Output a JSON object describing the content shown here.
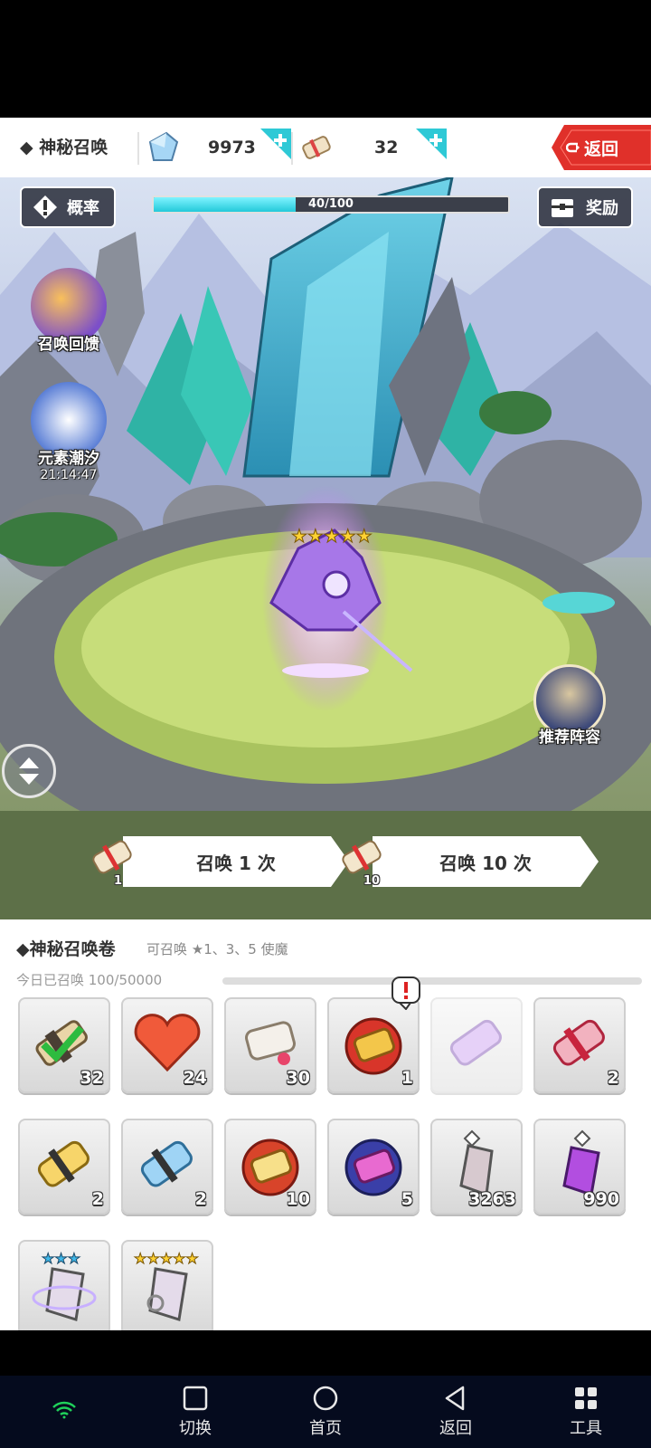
{
  "header": {
    "title": "◆ 神秘召唤",
    "gems": "9973",
    "scrolls": "32",
    "back_label": "返回"
  },
  "scene": {
    "rate_label": "概率",
    "reward_label": "奖励",
    "progress_text": "40/100",
    "progress_value": 0.4,
    "side_feedback_label": "召唤回馈",
    "side_element_label": "元素潮汐",
    "side_element_timer": "21:14:47",
    "recommend_label": "推荐阵容",
    "summon_one_label": "召唤 1 次",
    "summon_one_cost": "1",
    "summon_ten_label": "召唤 10 次",
    "summon_ten_cost": "10"
  },
  "panel": {
    "title": "◆神秘召唤卷",
    "subtitle": "可召唤 ★1、3、5 使魔",
    "today": "今日已召唤 100/50000",
    "items": [
      {
        "icon": "scroll-check-icon",
        "count": "32"
      },
      {
        "icon": "heart-icon",
        "count": "24"
      },
      {
        "icon": "white-scroll-icon",
        "count": "30"
      },
      {
        "icon": "red-gold-scroll-icon",
        "count": "1"
      },
      {
        "icon": "purple-scroll-icon",
        "count": ""
      },
      {
        "icon": "red-scroll-icon",
        "count": "2"
      },
      {
        "icon": "yellow-scroll-icon",
        "count": "2"
      },
      {
        "icon": "blue-scroll-icon",
        "count": "2"
      },
      {
        "icon": "fire-scroll-icon",
        "count": "10"
      },
      {
        "icon": "dark-scroll-icon",
        "count": "5"
      },
      {
        "icon": "silver-shard-icon",
        "count": "3263"
      },
      {
        "icon": "purple-shard-icon",
        "count": "990"
      },
      {
        "icon": "three-star-shard-icon",
        "count": ""
      },
      {
        "icon": "five-star-shard-icon",
        "count": ""
      }
    ]
  },
  "nav": {
    "switch_label": "切换",
    "home_label": "首页",
    "back_label": "返回",
    "tools_label": "工具"
  },
  "colors": {
    "accent_cyan": "#2ec9d6",
    "back_red": "#e0302a"
  }
}
